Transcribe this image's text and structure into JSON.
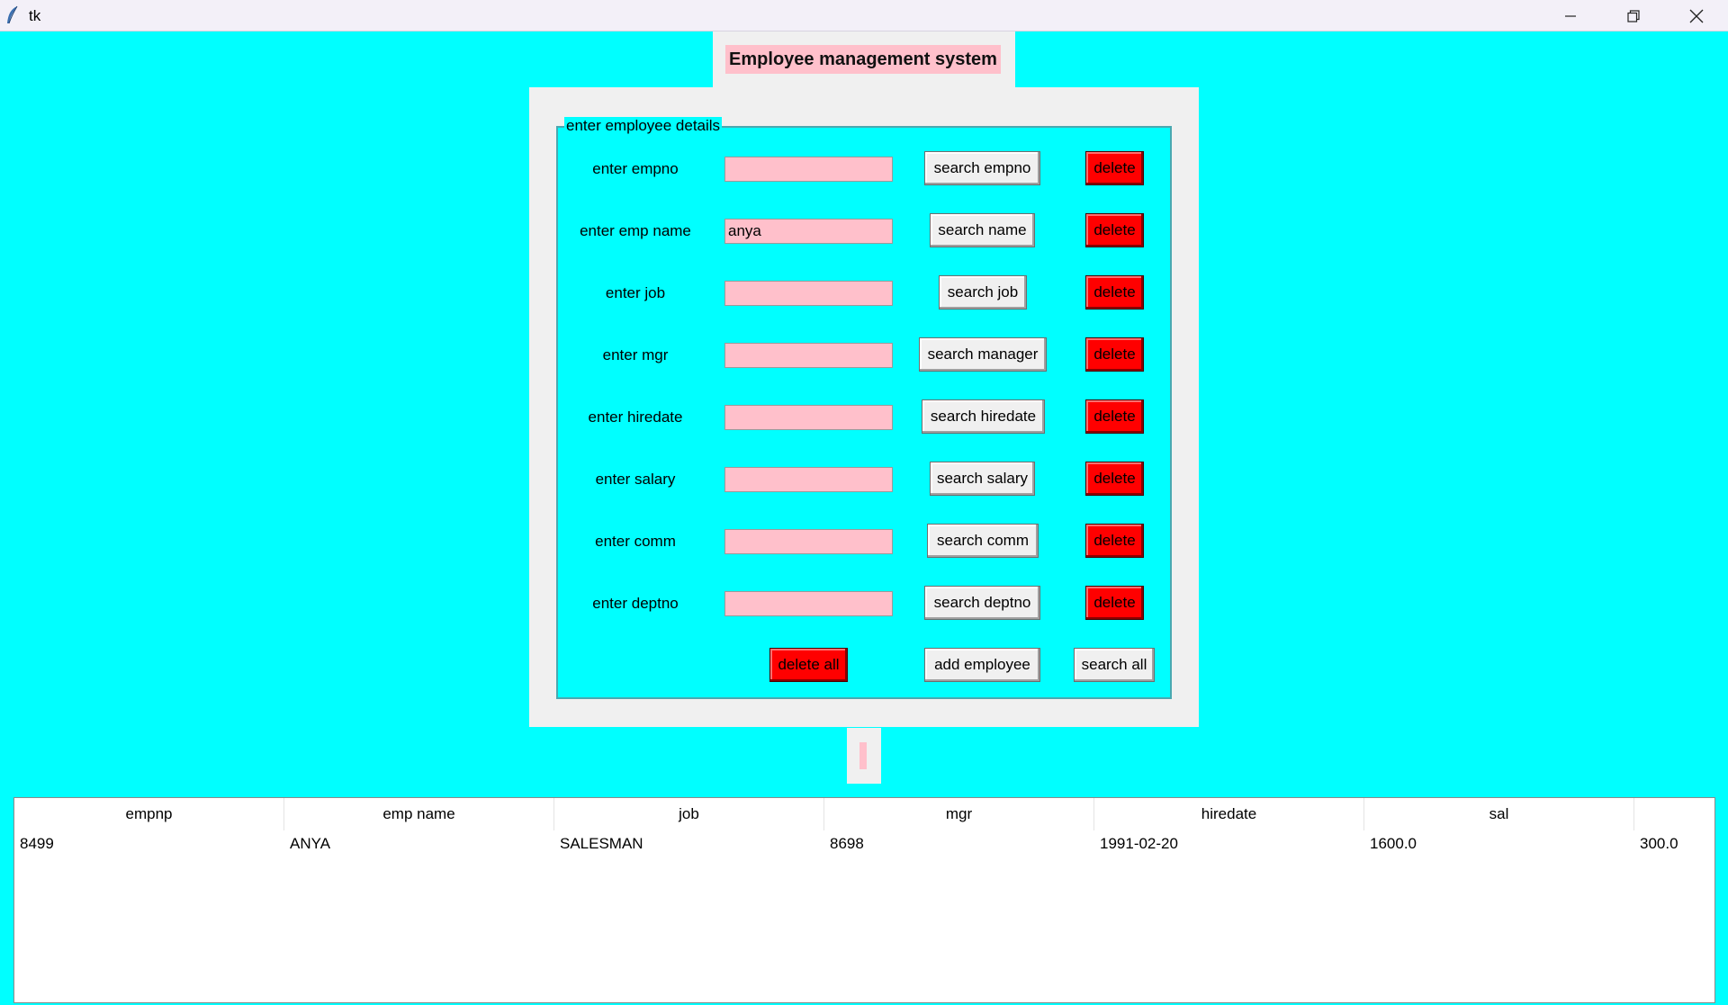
{
  "window": {
    "title": "tk"
  },
  "header": {
    "title": "Employee management system"
  },
  "group": {
    "legend": "enter employee details"
  },
  "fields": [
    {
      "label": "enter empno",
      "value": "",
      "search_label": "search empno",
      "delete_label": "delete"
    },
    {
      "label": "enter emp name",
      "value": "anya",
      "search_label": "search name",
      "delete_label": "delete"
    },
    {
      "label": "enter job",
      "value": "",
      "search_label": "search job",
      "delete_label": "delete"
    },
    {
      "label": "enter mgr",
      "value": "",
      "search_label": "search manager",
      "delete_label": "delete"
    },
    {
      "label": "enter hiredate",
      "value": "",
      "search_label": "search hiredate",
      "delete_label": "delete"
    },
    {
      "label": "enter salary",
      "value": "",
      "search_label": "search salary",
      "delete_label": "delete"
    },
    {
      "label": "enter comm",
      "value": "",
      "search_label": "search comm",
      "delete_label": "delete"
    },
    {
      "label": "enter deptno",
      "value": "",
      "search_label": "search deptno",
      "delete_label": "delete"
    }
  ],
  "actions": {
    "delete_all": "delete all",
    "add_employee": "add employee",
    "search_all": "search all"
  },
  "table": {
    "columns": [
      "empnp",
      "emp name",
      "job",
      "mgr",
      "hiredate",
      "sal",
      ""
    ],
    "rows": [
      [
        "8499",
        "ANYA",
        "SALESMAN",
        "8698",
        "1991-02-20",
        "1600.0",
        "300.0"
      ]
    ]
  },
  "colors": {
    "background": "#00ffff",
    "entry": "#ffc0cb",
    "danger": "#ff0000",
    "panel": "#f0f0f0"
  },
  "icons": {
    "app": "feather-icon",
    "minimize": "minimize-icon",
    "restore": "restore-icon",
    "close": "close-icon"
  }
}
